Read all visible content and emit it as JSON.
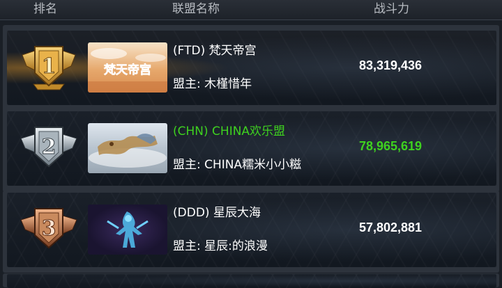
{
  "header": {
    "rank_label": "排名",
    "name_label": "联盟名称",
    "power_label": "战斗力"
  },
  "colors": {
    "highlight": "#3ed11f",
    "gold": "#d9a441",
    "silver": "#b9c4cc",
    "bronze": "#c07a4e"
  },
  "rows": [
    {
      "rank": "1",
      "guild": "(FTD) 梵天帝宫",
      "leader": "盟主: 木槿惜年",
      "power": "83,319,436",
      "emblem_text": "梵天帝宫",
      "medal_color": "gold",
      "highlight": false
    },
    {
      "rank": "2",
      "guild": "(CHN) CHINA欢乐盟",
      "leader": "盟主: CHINA糯米小小糍",
      "power": "78,965,619",
      "medal_color": "silver",
      "highlight": true
    },
    {
      "rank": "3",
      "guild": "(DDD) 星辰大海",
      "leader": "盟主: 星辰:的浪漫",
      "power": "57,802,881",
      "medal_color": "bronze",
      "highlight": false
    }
  ]
}
